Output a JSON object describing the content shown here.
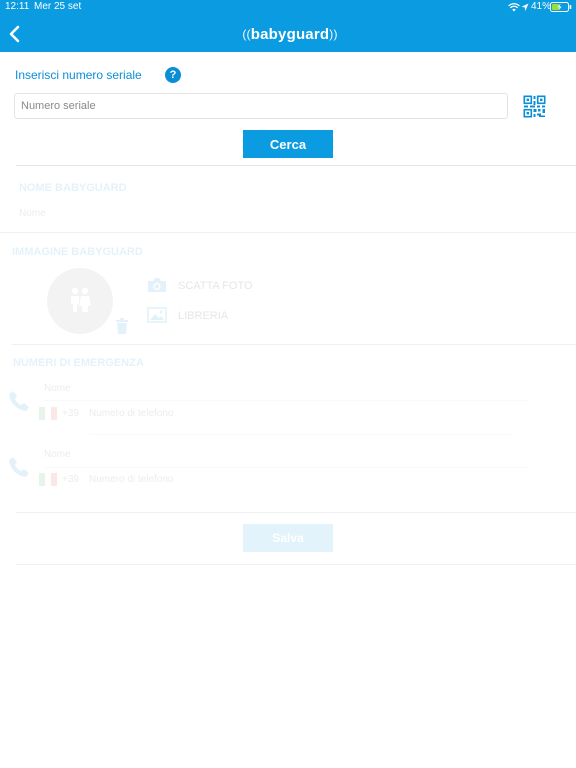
{
  "status_bar": {
    "time": "12:11",
    "date": "Mer 25 set",
    "battery": "41%"
  },
  "header": {
    "logo_text": "babyguard",
    "back_icon": "chevron-left-icon"
  },
  "serial_section": {
    "title": "Inserisci numero seriale",
    "placeholder": "Numero seriale",
    "value": "",
    "search_label": "Cerca"
  },
  "name_section": {
    "title": "NOME BABYGUARD",
    "placeholder": "Nome"
  },
  "image_section": {
    "title": "IMMAGINE BABYGUARD",
    "take_photo": "SCATTA FOTO",
    "library": "LIBRERIA"
  },
  "emergency_section": {
    "title": "NUMERI DI EMERGENZA",
    "contacts": [
      {
        "name_placeholder": "Nome",
        "prefix": "+39",
        "phone_placeholder": "Numero di telefono"
      },
      {
        "name_placeholder": "Nome",
        "prefix": "+39",
        "phone_placeholder": "Numero di telefono"
      }
    ]
  },
  "save_label": "Salva",
  "colors": {
    "brand_blue": "#0a9be0",
    "title_blue": "#0a8fd6",
    "flag_green": "#2e9e48",
    "flag_red": "#d9342b"
  }
}
